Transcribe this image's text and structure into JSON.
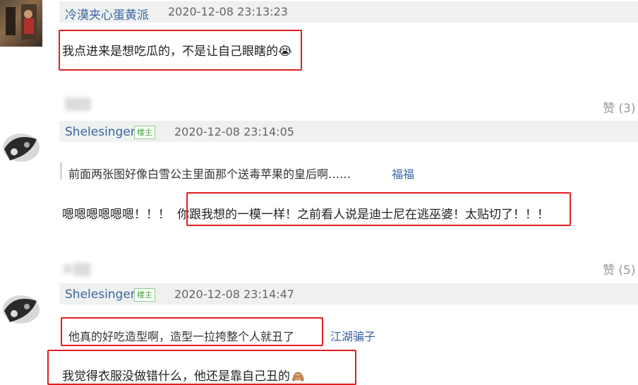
{
  "comments": [
    {
      "username": "冷漠夹心蛋黄派",
      "time": "2020-12-08 23:13:23",
      "text": "我点进来是想吃瓜的，不是让自己眼瞎的",
      "emoji": "😭",
      "reply_blurred": "▒▒▒",
      "likes": "赞 (3)"
    },
    {
      "username": "Shelesinger",
      "badge": "楼主",
      "time": "2020-12-08 23:14:05",
      "quote": "前面两张图好像白雪公主里面那个送毒苹果的皇后啊……",
      "quote_author": "福福",
      "text_prefix": "嗯嗯嗯嗯嗯嗯！！！",
      "text_main": "你跟我想的一模一样！之前看人说是迪士尼在逃巫婆！太贴切了",
      "text_suffix": "！！！",
      "reply_blurred": "来▒▒",
      "likes": "赞 (5)"
    },
    {
      "username": "Shelesinger",
      "badge": "楼主",
      "time": "2020-12-08 23:14:47",
      "quote": "他真的好吃造型啊，造型一拉挎整个人就丑了",
      "quote_author": "江湖骗子",
      "text": "我觉得衣服没做错什么，他还是靠自己丑的",
      "emoji": "🙈"
    }
  ],
  "colors": {
    "username": "#3c64a4",
    "header_bg": "#eef1ef",
    "highlight_box": "#e02020",
    "badge": "#3fa33f"
  }
}
